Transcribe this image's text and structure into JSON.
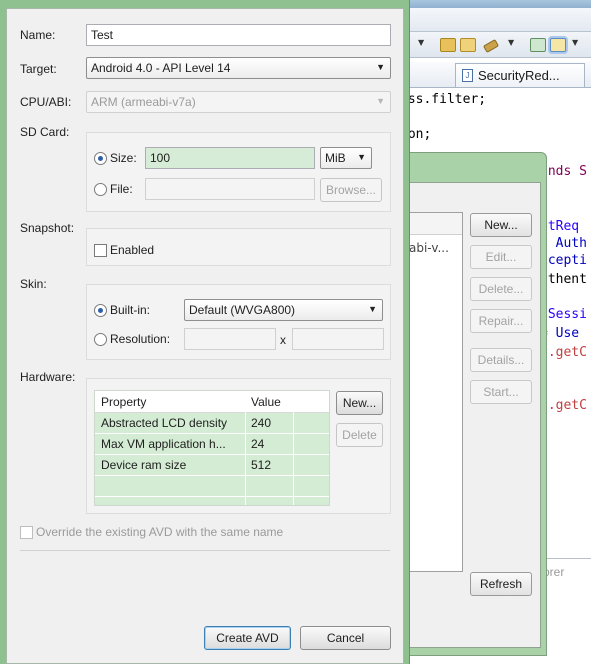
{
  "ide": {
    "editor_tab_label": "SecurityRed...",
    "code_lines": [
      {
        "text": "ess.filter;",
        "color": "#000000"
      },
      {
        "text": "ion;",
        "color": "#000000"
      },
      {
        "text": "ends S",
        "color": "#7f0055"
      },
      {
        "text": "etReq",
        "color": "#2a00ff"
      },
      {
        "text": ", Auth",
        "color": "#0000c0"
      },
      {
        "text": "xcepti",
        "color": "#0000c0"
      },
      {
        "text": "uthent",
        "color": "#000000"
      },
      {
        "text": "tSessi",
        "color": "#2a00ff"
      },
      {
        "text": "= Use",
        "color": "#0000c0"
      },
      {
        "text": "t.getC",
        "color": "#c04040"
      },
      {
        "text": "t.getC",
        "color": "#c04040"
      }
    ],
    "bottom_panel_text": "orer"
  },
  "avd_manager": {
    "list_row_text": "abi-v...",
    "buttons": {
      "new": "New...",
      "edit": "Edit...",
      "delete": "Delete...",
      "repair": "Repair...",
      "details": "Details...",
      "start": "Start...",
      "refresh": "Refresh"
    }
  },
  "dialog": {
    "name_label": "Name:",
    "name_value": "Test",
    "target_label": "Target:",
    "target_value": "Android 4.0 - API Level 14",
    "cpu_label": "CPU/ABI:",
    "cpu_value": "ARM (armeabi-v7a)",
    "sdcard_label": "SD Card:",
    "size_label": "Size:",
    "size_value": "100",
    "size_unit": "MiB",
    "file_label": "File:",
    "file_value": "",
    "browse_label": "Browse...",
    "snapshot_label": "Snapshot:",
    "enabled_label": "Enabled",
    "skin_label": "Skin:",
    "builtin_label": "Built-in:",
    "builtin_value": "Default (WVGA800)",
    "resolution_label": "Resolution:",
    "resolution_width": "",
    "resolution_x": "x",
    "resolution_height": "",
    "hardware_label": "Hardware:",
    "hw_columns": [
      "Property",
      "Value"
    ],
    "hw_rows": [
      {
        "property": "Abstracted LCD density",
        "value": "240"
      },
      {
        "property": "Max VM application h...",
        "value": "24"
      },
      {
        "property": "Device ram size",
        "value": "512"
      }
    ],
    "hw_new_label": "New...",
    "hw_delete_label": "Delete",
    "override_label": "Override the existing AVD with the same name",
    "create_label": "Create AVD",
    "cancel_label": "Cancel"
  }
}
